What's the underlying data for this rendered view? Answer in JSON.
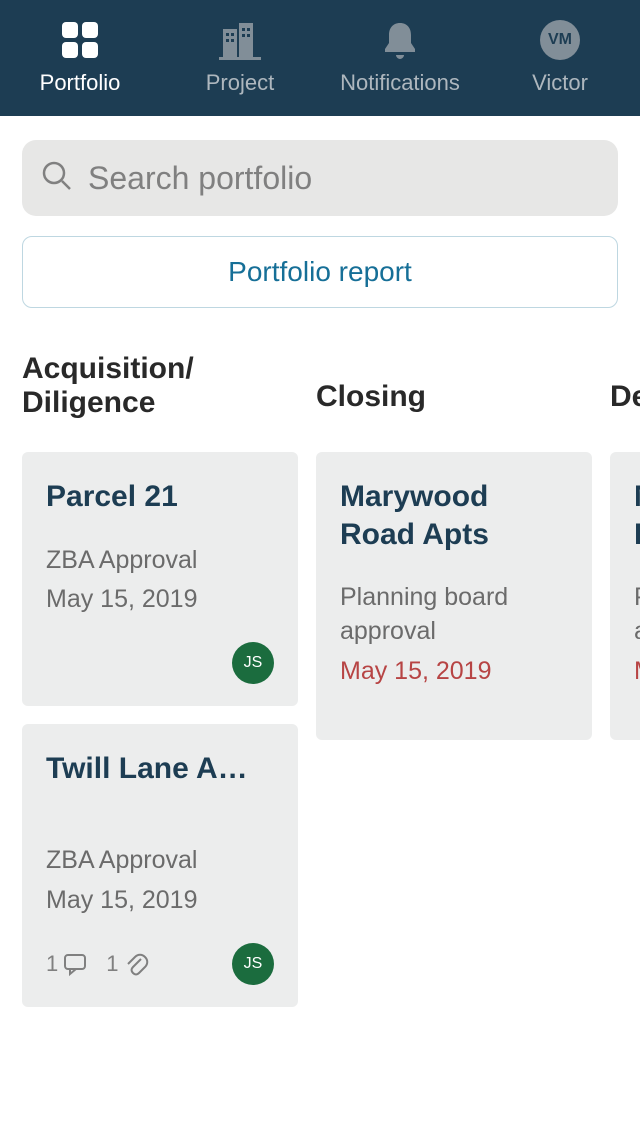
{
  "nav": {
    "portfolio": "Portfolio",
    "project": "Project",
    "notifications": "Notifications",
    "user_name": "Victor",
    "user_initials": "VM"
  },
  "search": {
    "placeholder": "Search portfolio"
  },
  "actions": {
    "report": "Portfolio report"
  },
  "columns": {
    "acquisition": "Acquisition/ Diligence",
    "closing": "Closing",
    "design": "De"
  },
  "cards": {
    "parcel21": {
      "title": "Parcel 21",
      "task": "ZBA Approval",
      "date": "May 15, 2019",
      "assignee": "JS"
    },
    "twill": {
      "title": "Twill Lane A…",
      "task": "ZBA Approval",
      "date": "May 15, 2019",
      "comments": "1",
      "attachments": "1",
      "assignee": "JS"
    },
    "marywood": {
      "title": "Marywood Road Apts",
      "task": "Planning board approval",
      "date": "May 15, 2019"
    },
    "partial": {
      "title": "M P",
      "task": "P a",
      "date": "M"
    }
  }
}
